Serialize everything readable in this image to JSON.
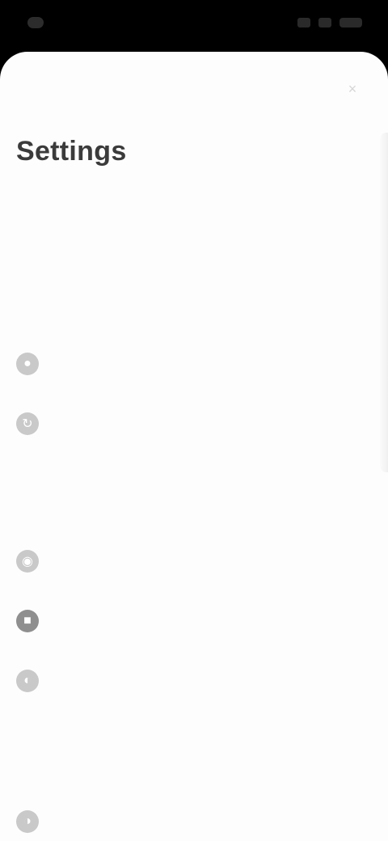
{
  "status_bar": {
    "time": "",
    "icons": [
      "signal-icon",
      "wifi-icon",
      "battery-icon"
    ]
  },
  "sheet": {
    "title": "Settings",
    "account": {
      "badge": "",
      "name": "",
      "hint": ""
    },
    "sections": [
      {
        "header": "",
        "items": [
          {
            "label": "",
            "icon": "person-icon"
          },
          {
            "label": "",
            "icon": "sync-icon"
          }
        ]
      },
      {
        "header": "",
        "items": [
          {
            "label": "",
            "icon": "browser-icon"
          },
          {
            "label": "",
            "icon": "privacy-icon"
          },
          {
            "label": "",
            "icon": "tracking-icon"
          }
        ]
      },
      {
        "header": "",
        "items": [
          {
            "label": "",
            "icon": "theme-icon"
          }
        ]
      }
    ]
  },
  "colors": {
    "sheet_background": "#fdfdfd",
    "accent": "#c7b1f2",
    "status_bar": "#000000"
  }
}
